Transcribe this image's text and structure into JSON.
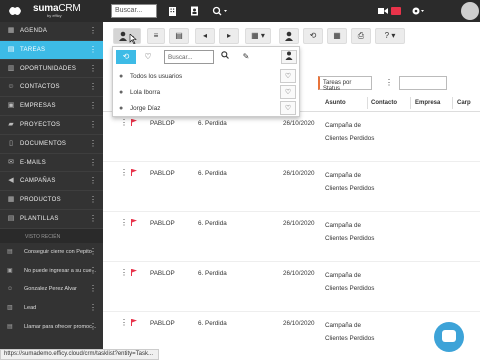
{
  "app": {
    "logo_text": "suma",
    "logo_text2": "CRM",
    "logo_sub": "by efficy",
    "search_placeholder": "Buscar...",
    "colors": {
      "accent": "#3dbbe6",
      "sidebar_bg": "#333333",
      "topbar_bg": "#2b2b2b",
      "flag": "#e8334a"
    }
  },
  "sidebar": {
    "items": [
      {
        "label": "AGENDA",
        "icon": "calendar-icon"
      },
      {
        "label": "TAREAS",
        "icon": "tasks-icon",
        "active": true
      },
      {
        "label": "OPORTUNIDADES",
        "icon": "opportunity-icon"
      },
      {
        "label": "CONTACTOS",
        "icon": "contacts-icon"
      },
      {
        "label": "EMPRESAS",
        "icon": "company-icon"
      },
      {
        "label": "PROYECTOS",
        "icon": "folder-icon"
      },
      {
        "label": "DOCUMENTOS",
        "icon": "document-icon"
      },
      {
        "label": "E-MAILS",
        "icon": "email-icon"
      },
      {
        "label": "CAMPAÑAS",
        "icon": "campaign-icon"
      },
      {
        "label": "PRODUCTOS",
        "icon": "product-icon"
      },
      {
        "label": "PLANTILLAS",
        "icon": "template-icon"
      }
    ],
    "recent_header": "VISTO RECIÉN",
    "recent": [
      {
        "label": "Conseguir cierre con Pepito"
      },
      {
        "label": "No puede ingresar a su cue..."
      },
      {
        "label": "Gonzalez Perez Alvar"
      },
      {
        "label": "Lead"
      },
      {
        "label": "Llamar para ofrecer promoc..."
      }
    ]
  },
  "popup": {
    "search_placeholder": "Buscar...",
    "items": [
      {
        "label": "Todos los usuarios"
      },
      {
        "label": "Lola Iborra"
      },
      {
        "label": "Jorge Díaz"
      }
    ]
  },
  "filters": {
    "status_select": "Tareas por Status",
    "search_placeholder": ""
  },
  "table": {
    "columns": [
      "Asunto",
      "Contacto",
      "Empresa",
      "Carp"
    ],
    "rows": [
      {
        "user": "PABLOP",
        "status": "6. Perdida",
        "date": "26/10/2020",
        "subject": "Campaña de Clientes Perdidos"
      },
      {
        "user": "PABLOP",
        "status": "6. Perdida",
        "date": "26/10/2020",
        "subject": "Campaña de Clientes Perdidos"
      },
      {
        "user": "PABLOP",
        "status": "6. Perdida",
        "date": "26/10/2020",
        "subject": "Campaña de Clientes Perdidos"
      },
      {
        "user": "PABLOP",
        "status": "6. Perdida",
        "date": "26/10/2020",
        "subject": "Campaña de Clientes Perdidos"
      },
      {
        "user": "PABLOP",
        "status": "6. Perdida",
        "date": "26/10/2020",
        "subject": "Campaña de Clientes Perdidos"
      }
    ]
  },
  "statusbar": {
    "url": "https://sumademo.efficy.cloud/crm/tasklist?entity=Task..."
  }
}
